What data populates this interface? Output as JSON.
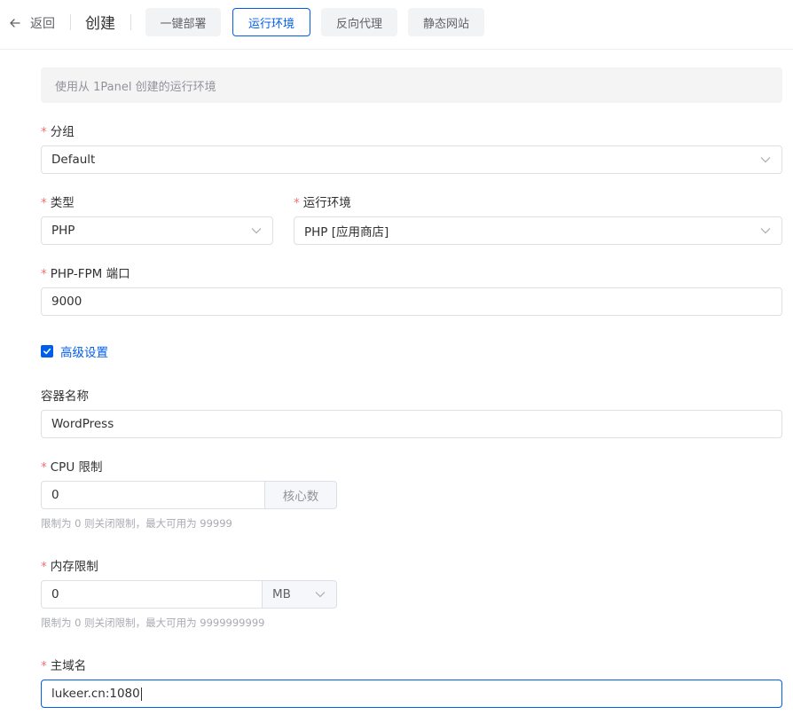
{
  "header": {
    "back_label": "返回",
    "title": "创建",
    "tabs": [
      {
        "label": "一键部署",
        "active": false
      },
      {
        "label": "运行环境",
        "active": true
      },
      {
        "label": "反向代理",
        "active": false
      },
      {
        "label": "静态网站",
        "active": false
      }
    ]
  },
  "notice": "使用从 1Panel 创建的运行环境",
  "form": {
    "group": {
      "label": "分组",
      "required": true,
      "value": "Default"
    },
    "type": {
      "label": "类型",
      "required": true,
      "value": "PHP"
    },
    "runtime": {
      "label": "运行环境",
      "required": true,
      "value": "PHP [应用商店]"
    },
    "fpm_port": {
      "label": "PHP-FPM 端口",
      "required": true,
      "value": "9000"
    },
    "advanced": {
      "label": "高级设置",
      "checked": true
    },
    "container_name": {
      "label": "容器名称",
      "required": false,
      "value": "WordPress"
    },
    "cpu_limit": {
      "label": "CPU 限制",
      "required": true,
      "value": "0",
      "unit": "核心数",
      "hint": "限制为 0 则关闭限制，最大可用为 99999"
    },
    "memory_limit": {
      "label": "内存限制",
      "required": true,
      "value": "0",
      "unit": "MB",
      "hint": "限制为 0 则关闭限制，最大可用为 9999999999"
    },
    "primary_domain": {
      "label": "主域名",
      "required": true,
      "value": "lukeer.cn:1080"
    }
  },
  "colors": {
    "primary": "#005eeb",
    "required": "#f56c6c",
    "border": "#dcdfe6"
  }
}
